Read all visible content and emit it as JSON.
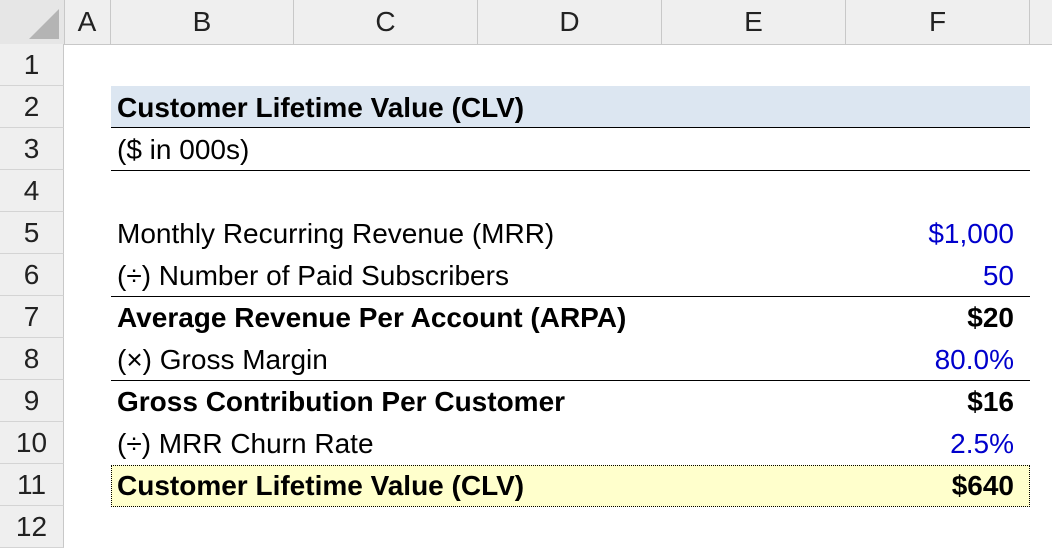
{
  "columns": [
    "A",
    "B",
    "C",
    "D",
    "E",
    "F"
  ],
  "rows": [
    "1",
    "2",
    "3",
    "4",
    "5",
    "6",
    "7",
    "8",
    "9",
    "10",
    "11",
    "12"
  ],
  "title": "Customer Lifetime Value (CLV)",
  "units": "($ in 000s)",
  "lines": [
    {
      "label": "Monthly Recurring Revenue (MRR)",
      "value": "$1,000"
    },
    {
      "label": "(÷) Number of Paid Subscribers",
      "value": "50"
    },
    {
      "label": "Average Revenue Per Account (ARPA)",
      "value": "$20"
    },
    {
      "label": "(×) Gross Margin",
      "value": "80.0%"
    },
    {
      "label": "Gross Contribution Per Customer",
      "value": "$16"
    },
    {
      "label": "(÷) MRR Churn Rate",
      "value": "2.5%"
    },
    {
      "label": "Customer Lifetime Value (CLV)",
      "value": "$640"
    }
  ],
  "colors": {
    "input_text": "#0000cc",
    "title_fill": "#dce6f1",
    "result_fill": "#ffffcc",
    "header_fill": "#efefef"
  }
}
